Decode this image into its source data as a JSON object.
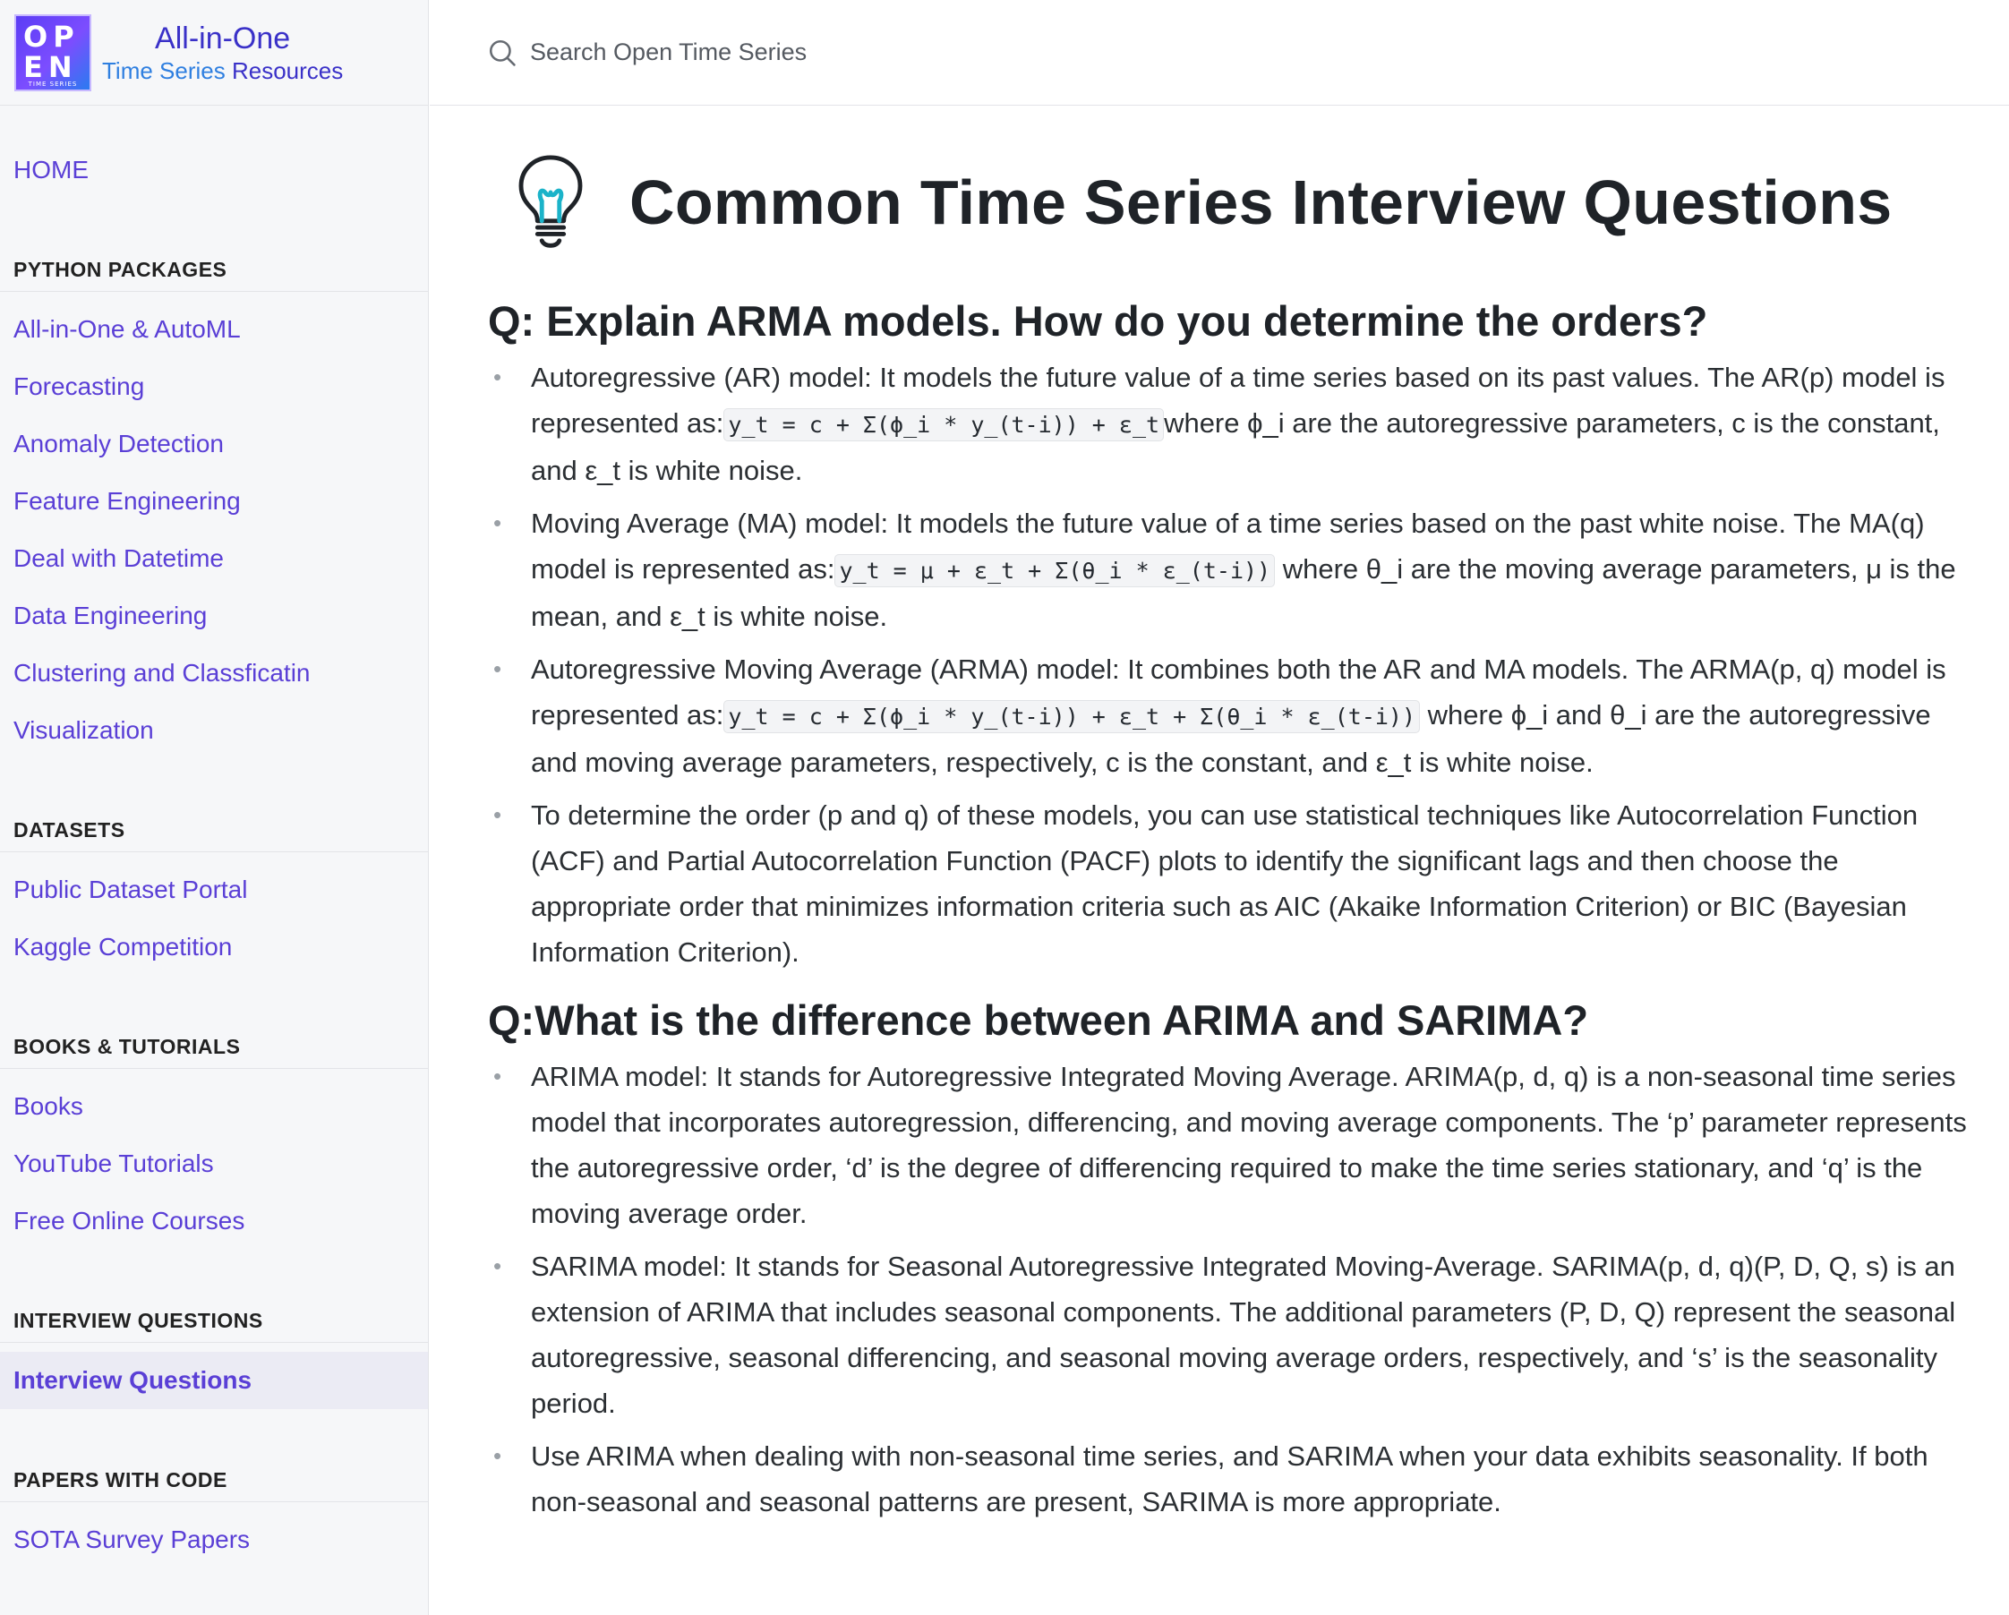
{
  "brand": {
    "logo_row1": "OP",
    "logo_row2": "EN",
    "logo_caption": "TIME SERIES",
    "title": "All-in-One",
    "subtitle_highlight": "Time Series",
    "subtitle_rest": " Resources"
  },
  "search": {
    "placeholder": "Search Open Time Series"
  },
  "sidebar": {
    "home": "HOME",
    "sections": [
      {
        "title": "PYTHON PACKAGES",
        "items": [
          "All-in-One & AutoML",
          "Forecasting",
          "Anomaly Detection",
          "Feature Engineering",
          "Deal with Datetime",
          "Data Engineering",
          "Clustering and Classficatin",
          "Visualization"
        ]
      },
      {
        "title": "DATASETS",
        "items": [
          "Public Dataset Portal",
          "Kaggle Competition"
        ]
      },
      {
        "title": "BOOKS & TUTORIALS",
        "items": [
          "Books",
          "YouTube Tutorials",
          "Free Online Courses"
        ]
      },
      {
        "title": "INTERVIEW QUESTIONS",
        "items": [
          "Interview Questions"
        ]
      },
      {
        "title": "PAPERS WITH CODE",
        "items": [
          "SOTA Survey Papers"
        ]
      }
    ],
    "active_item": "Interview Questions"
  },
  "page": {
    "title": "Common Time Series Interview Questions",
    "icon": "lightbulb-icon"
  },
  "q1": {
    "heading": "Q: Explain ARMA models. How do you determine the orders?",
    "a1_pre": "Autoregressive (AR) model: It models the future value of a time series based on its past values. The AR(p) model is represented as:",
    "a1_code": "y_t = c + Σ(ϕ_i * y_(t-i)) + ε_t",
    "a1_post": "where ϕ_i are the autoregressive parameters, c is the constant, and ε_t is white noise.",
    "a2_pre": "Moving Average (MA) model: It models the future value of a time series based on the past white noise. The MA(q) model is represented as:",
    "a2_code": "y_t = μ + ε_t + Σ(θ_i * ε_(t-i))",
    "a2_post": " where θ_i are the moving average parameters, μ is the mean, and ε_t is white noise.",
    "a3_pre": "Autoregressive Moving Average (ARMA) model: It combines both the AR and MA models. The ARMA(p, q) model is represented as:",
    "a3_code": "y_t = c + Σ(ϕ_i * y_(t-i)) + ε_t + Σ(θ_i * ε_(t-i))",
    "a3_post": " where ϕ_i and θ_i are the autoregressive and moving average parameters, respectively, c is the constant, and ε_t is white noise.",
    "a4": "To determine the order (p and q) of these models, you can use statistical techniques like Autocorrelation Function (ACF) and Partial Autocorrelation Function (PACF) plots to identify the significant lags and then choose the appropriate order that minimizes information criteria such as AIC (Akaike Information Criterion) or BIC (Bayesian Information Criterion)."
  },
  "q2": {
    "heading": "Q:What is the difference between ARIMA and SARIMA?",
    "a1": "ARIMA model: It stands for Autoregressive Integrated Moving Average. ARIMA(p, d, q) is a non-seasonal time series model that incorporates autoregression, differencing, and moving average components. The ‘p’ parameter represents the autoregressive order, ‘d’ is the degree of differencing required to make the time series stationary, and ‘q’ is the moving average order.",
    "a2": "SARIMA model: It stands for Seasonal Autoregressive Integrated Moving-Average. SARIMA(p, d, q)(P, D, Q, s) is an extension of ARIMA that includes seasonal components. The additional parameters (P, D, Q) represent the seasonal autoregressive, seasonal differencing, and seasonal moving average orders, respectively, and ‘s’ is the seasonality period.",
    "a3": "Use ARIMA when dealing with non-seasonal time series, and SARIMA when your data exhibits seasonality. If both non-seasonal and seasonal patterns are present, SARIMA is more appropriate."
  },
  "colors": {
    "link": "#5a3fd6",
    "brand": "#3a31c8",
    "active_bg": "#ebebf4"
  }
}
